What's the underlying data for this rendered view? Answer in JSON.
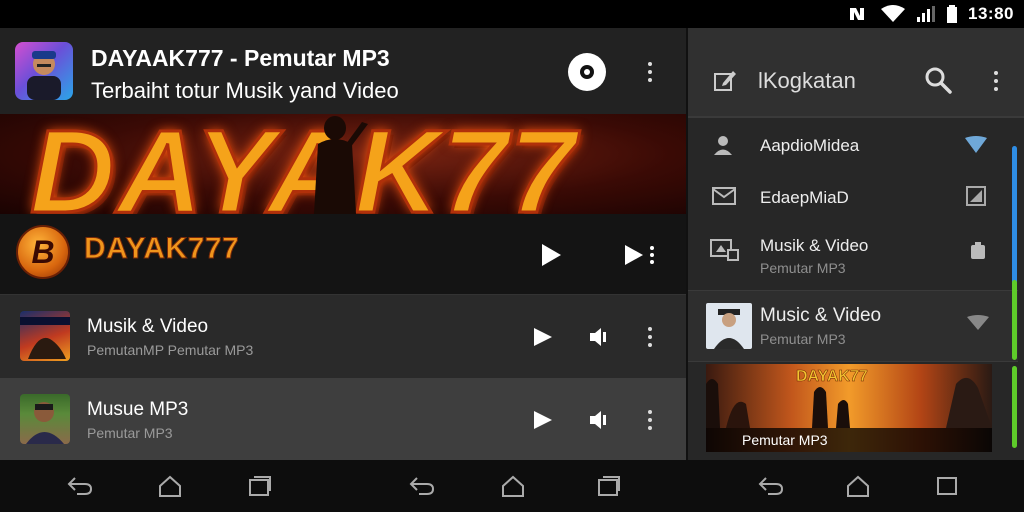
{
  "status": {
    "time": "13:80"
  },
  "header": {
    "title": "DAYAAK777 - Pemutar MP3",
    "subtitle": "Terbaiht totur Musik yand Video"
  },
  "banner": {
    "text": "DAYAK77"
  },
  "player": {
    "logo_letter": "B",
    "name": "DAYAK777"
  },
  "tracks": [
    {
      "title": "Musik & Video",
      "subtitle": "PemutanMP Pemutar MP3"
    },
    {
      "title": "Musue MP3",
      "subtitle": "Pemutar MP3"
    }
  ],
  "drawer": {
    "title": "lKogkatan",
    "items": [
      {
        "label": "AapdioMidea"
      },
      {
        "label": "EdaepMiaD"
      },
      {
        "label": "Musik & Video",
        "subtitle": "Pemutar MP3"
      }
    ],
    "music_item": {
      "title": "Music & Video",
      "subtitle": "Pemutar MP3"
    },
    "promo": {
      "tag": "DAYAK77",
      "label": "Pemutar MP3"
    }
  },
  "colors": {
    "accent": "#f0951c",
    "scroll_blue": "#2f8de4",
    "scroll_green": "#5ecb2a"
  }
}
